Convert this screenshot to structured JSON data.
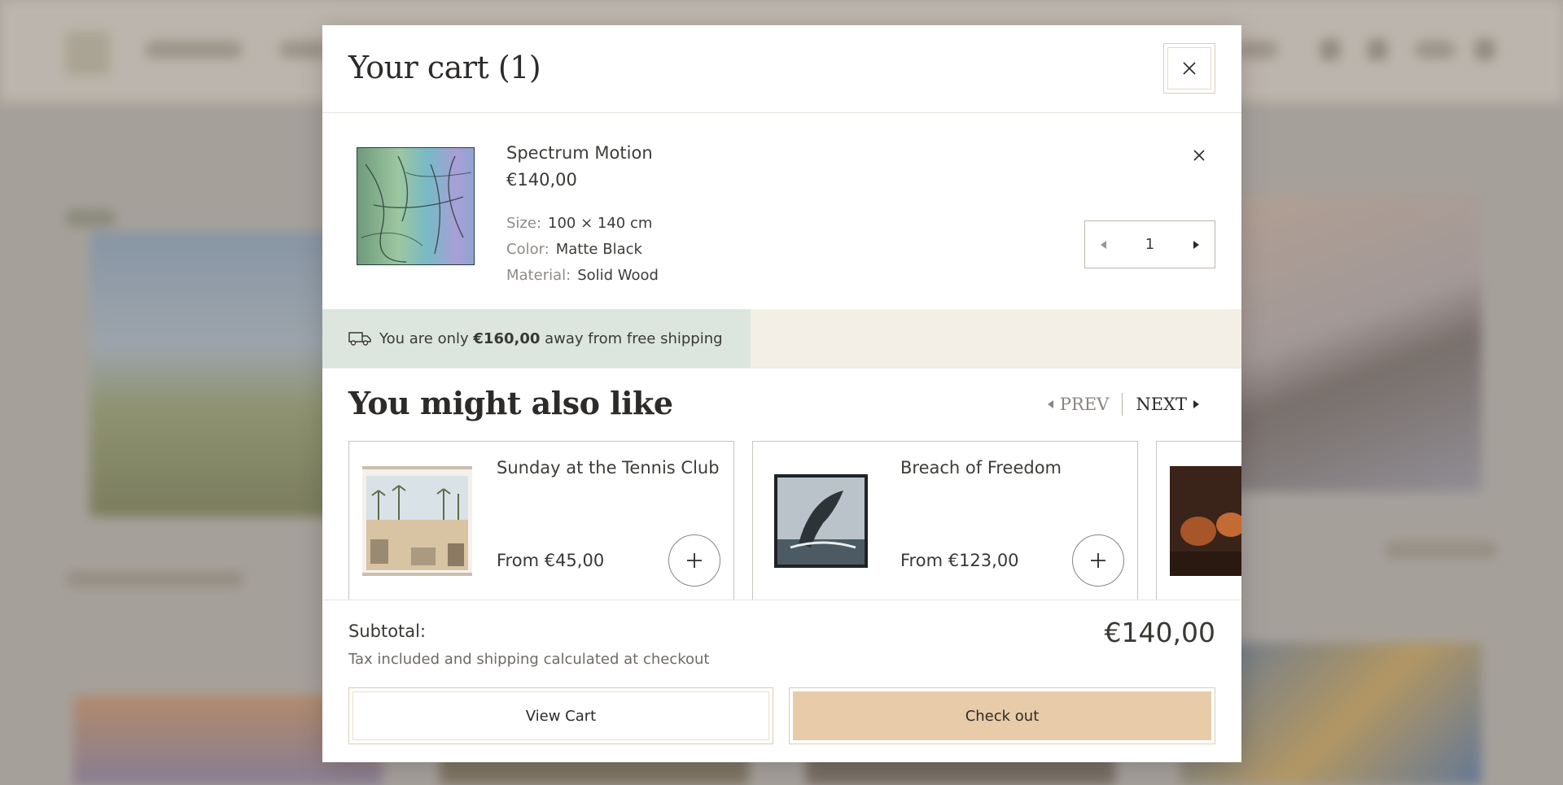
{
  "cart": {
    "title": "Your cart (1)",
    "close_icon": "close-icon",
    "items": [
      {
        "name": "Spectrum Motion",
        "price": "€140,00",
        "options": [
          {
            "key": "Size:",
            "value": "100 × 140 cm"
          },
          {
            "key": "Color:",
            "value": "Matte Black"
          },
          {
            "key": "Material:",
            "value": "Solid Wood"
          }
        ],
        "quantity": "1"
      }
    ],
    "shipping": {
      "prefix": "You are only",
      "amount": "€160,00",
      "suffix": "away from free shipping",
      "progress": 0.466,
      "icon": "truck-icon"
    },
    "recommendations": {
      "title": "You might also like",
      "prev_label": "PREV",
      "next_label": "NEXT",
      "products": [
        {
          "name": "Sunday at the Tennis Club",
          "price": "From €45,00"
        },
        {
          "name": "Breach of Freedom",
          "price": "From €123,00"
        },
        {
          "name": "",
          "price": ""
        }
      ]
    },
    "footer": {
      "subtotal_label": "Subtotal:",
      "subtotal_value": "€140,00",
      "note": "Tax included and shipping calculated at checkout",
      "view_cart_label": "View Cart",
      "checkout_label": "Check out"
    }
  },
  "colors": {
    "accent": "#e8cba9",
    "shipping_progress": "#dce6df",
    "shipping_track": "#f3efe6"
  }
}
